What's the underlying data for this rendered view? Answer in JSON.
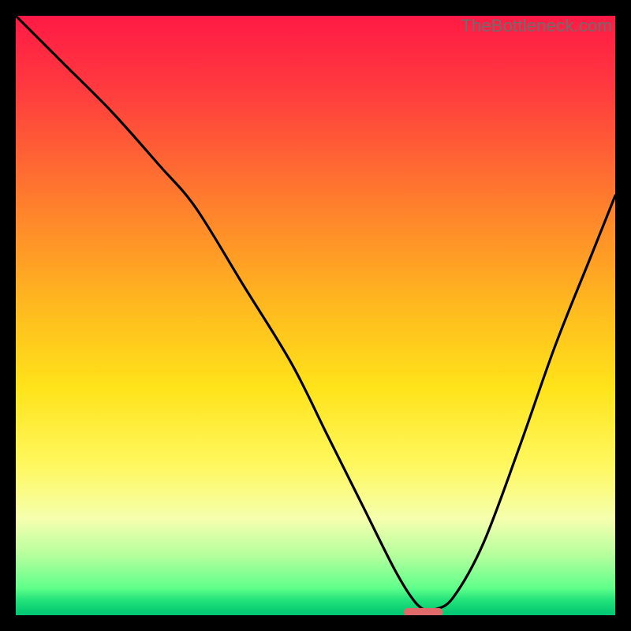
{
  "watermark": "TheBottleneck.com",
  "chart_data": {
    "type": "line",
    "title": "",
    "xlabel": "",
    "ylabel": "",
    "xlim": [
      0,
      100
    ],
    "ylim": [
      0,
      100
    ],
    "grid": false,
    "legend": false,
    "gradient_stops": [
      {
        "offset": 0.0,
        "color": "#ff1a45"
      },
      {
        "offset": 0.12,
        "color": "#ff3a3f"
      },
      {
        "offset": 0.3,
        "color": "#ff7a2e"
      },
      {
        "offset": 0.48,
        "color": "#ffb81f"
      },
      {
        "offset": 0.62,
        "color": "#ffe31a"
      },
      {
        "offset": 0.75,
        "color": "#fff85f"
      },
      {
        "offset": 0.84,
        "color": "#f5ffae"
      },
      {
        "offset": 0.9,
        "color": "#b5ff9d"
      },
      {
        "offset": 0.955,
        "color": "#5fff8a"
      },
      {
        "offset": 0.975,
        "color": "#22e27a"
      },
      {
        "offset": 1.0,
        "color": "#00c572"
      }
    ],
    "series": [
      {
        "name": "bottleneck-curve",
        "x": [
          0,
          8,
          16,
          24,
          30,
          38,
          46,
          52,
          58,
          63,
          66,
          68,
          70,
          73,
          78,
          84,
          90,
          96,
          100
        ],
        "y": [
          100,
          92,
          84,
          75,
          68,
          55,
          42,
          30,
          18,
          8,
          3,
          1,
          1,
          3,
          12,
          28,
          45,
          60,
          70
        ]
      }
    ],
    "marker": {
      "name": "optimal-marker",
      "x": 68,
      "y": 0.5,
      "width_pct": 6.5,
      "height_pct": 1.4,
      "color": "#e06a6a"
    }
  }
}
